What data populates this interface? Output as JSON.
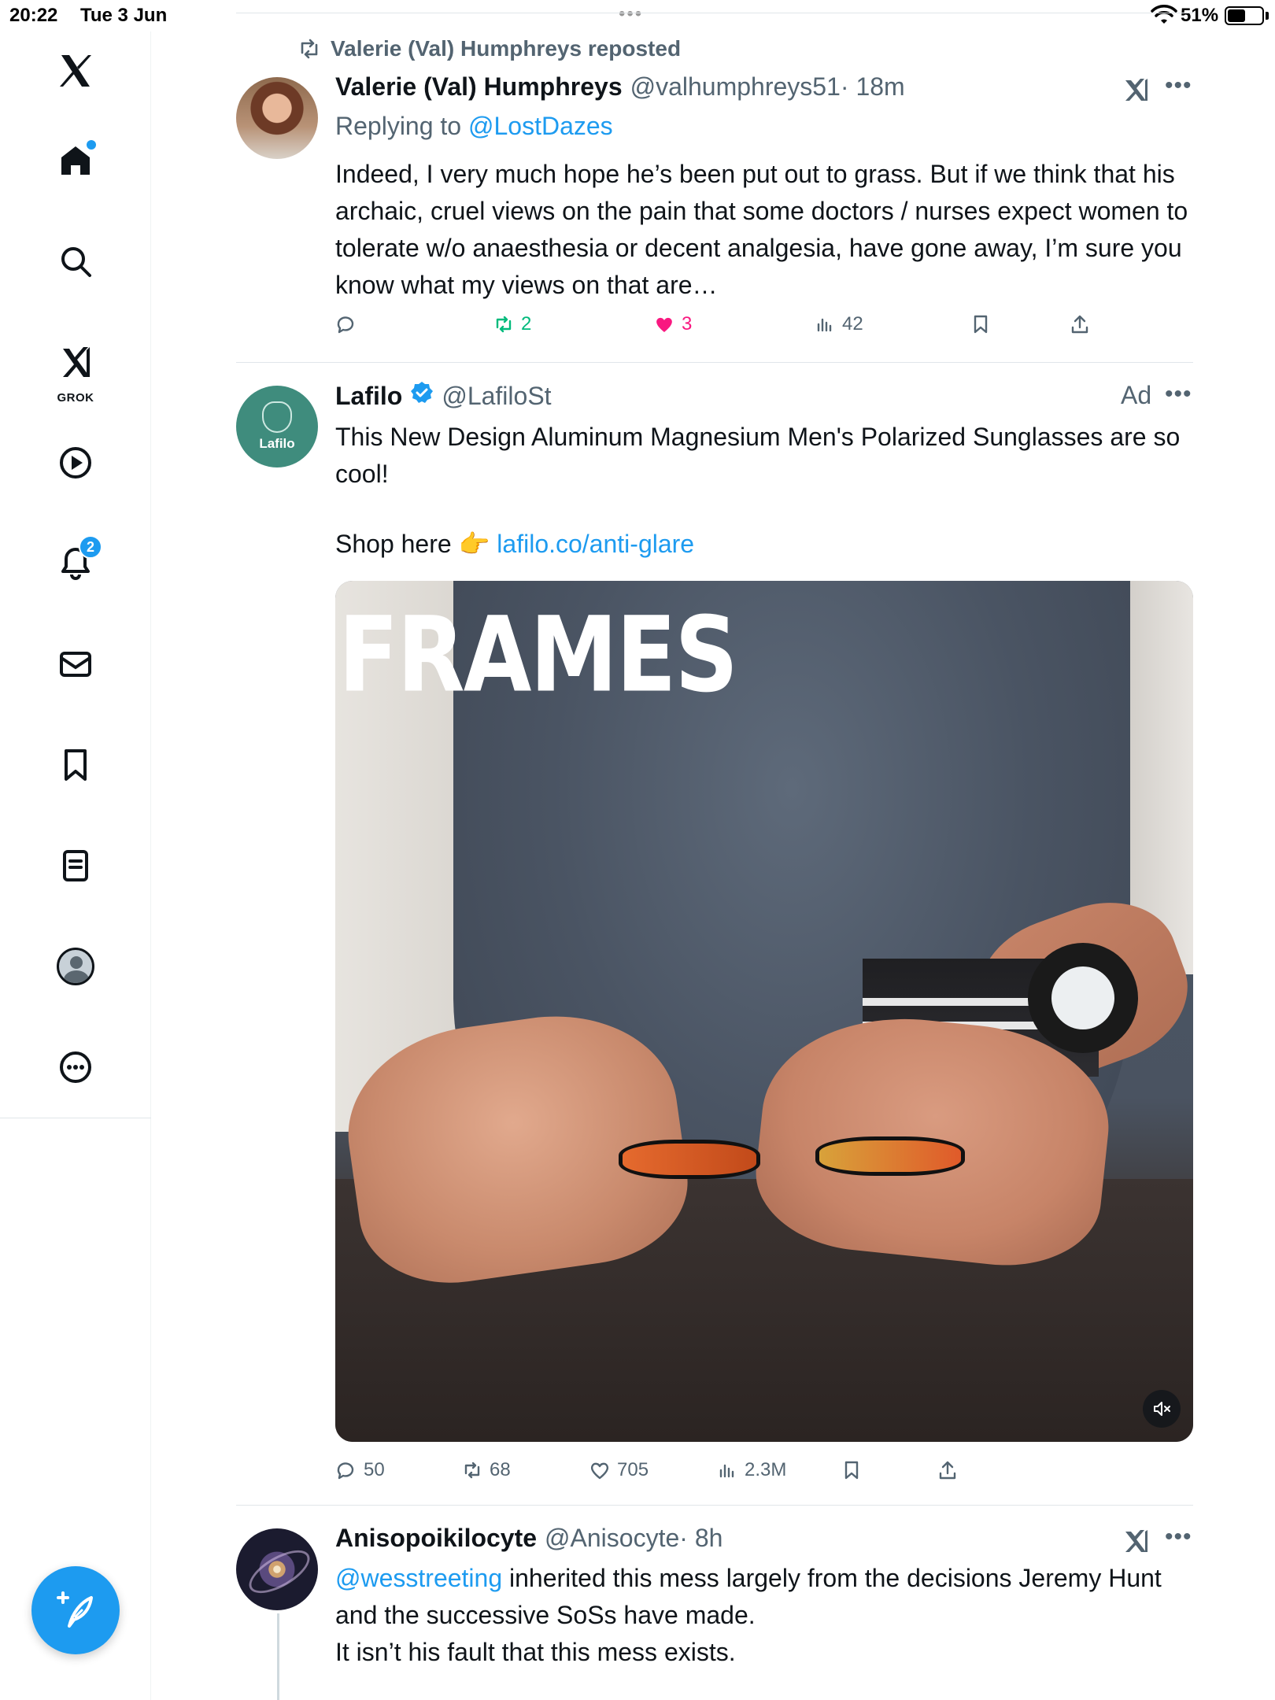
{
  "status_bar": {
    "time": "20:22",
    "date": "Tue 3 Jun",
    "battery": "51%"
  },
  "sidebar": {
    "items": [
      {
        "name": "home",
        "label": ""
      },
      {
        "name": "explore",
        "label": ""
      },
      {
        "name": "grok",
        "label": "GROK"
      },
      {
        "name": "videos",
        "label": ""
      },
      {
        "name": "notifications",
        "label": "",
        "badge": "2"
      },
      {
        "name": "messages",
        "label": ""
      },
      {
        "name": "bookmarks",
        "label": ""
      },
      {
        "name": "lists",
        "label": ""
      },
      {
        "name": "profile",
        "label": ""
      },
      {
        "name": "more",
        "label": ""
      }
    ]
  },
  "feed": {
    "tweets": [
      {
        "repost_label": "Valerie (Val) Humphreys reposted",
        "name": "Valerie (Val) Humphreys",
        "handle": "@valhumphreys51",
        "time": "· 18m",
        "replying_prefix": "Replying to ",
        "replying_to": "@LostDazes",
        "text": "Indeed, I very much hope he’s been put out to grass. But if we think that his archaic, cruel views on the pain that some doctors / nurses expect women to tolerate w/o anaesthesia or decent analgesia, have gone away, I’m sure you know what my views on that are…",
        "replies": "",
        "reposts": "2",
        "likes": "3",
        "views": "42"
      },
      {
        "name": "Lafilo",
        "handle": "@LafiloSt",
        "ad_label": "Ad",
        "avatar_text": "Lafilo",
        "text_line1": "This New Design Aluminum Magnesium Men's Polarized Sunglasses are so cool!",
        "shop_prefix": "Shop here 👉 ",
        "shop_link": "lafilo.co/anti-glare",
        "media_caption": "FRAMES",
        "replies": "50",
        "reposts": "68",
        "likes": "705",
        "views": "2.3M"
      },
      {
        "name": "Anisopoikilocyte",
        "handle": "@Anisocyte",
        "time": "· 8h",
        "mention": "@wesstreeting",
        "text_rest": " inherited this mess largely from the decisions Jeremy Hunt and the successive SoSs have made.",
        "text_line2": "It isn’t his fault that this mess exists."
      }
    ]
  },
  "colors": {
    "accent": "#1d9bf0",
    "repost_green": "#00ba7c",
    "like_pink": "#f91880",
    "muted": "#536471"
  }
}
